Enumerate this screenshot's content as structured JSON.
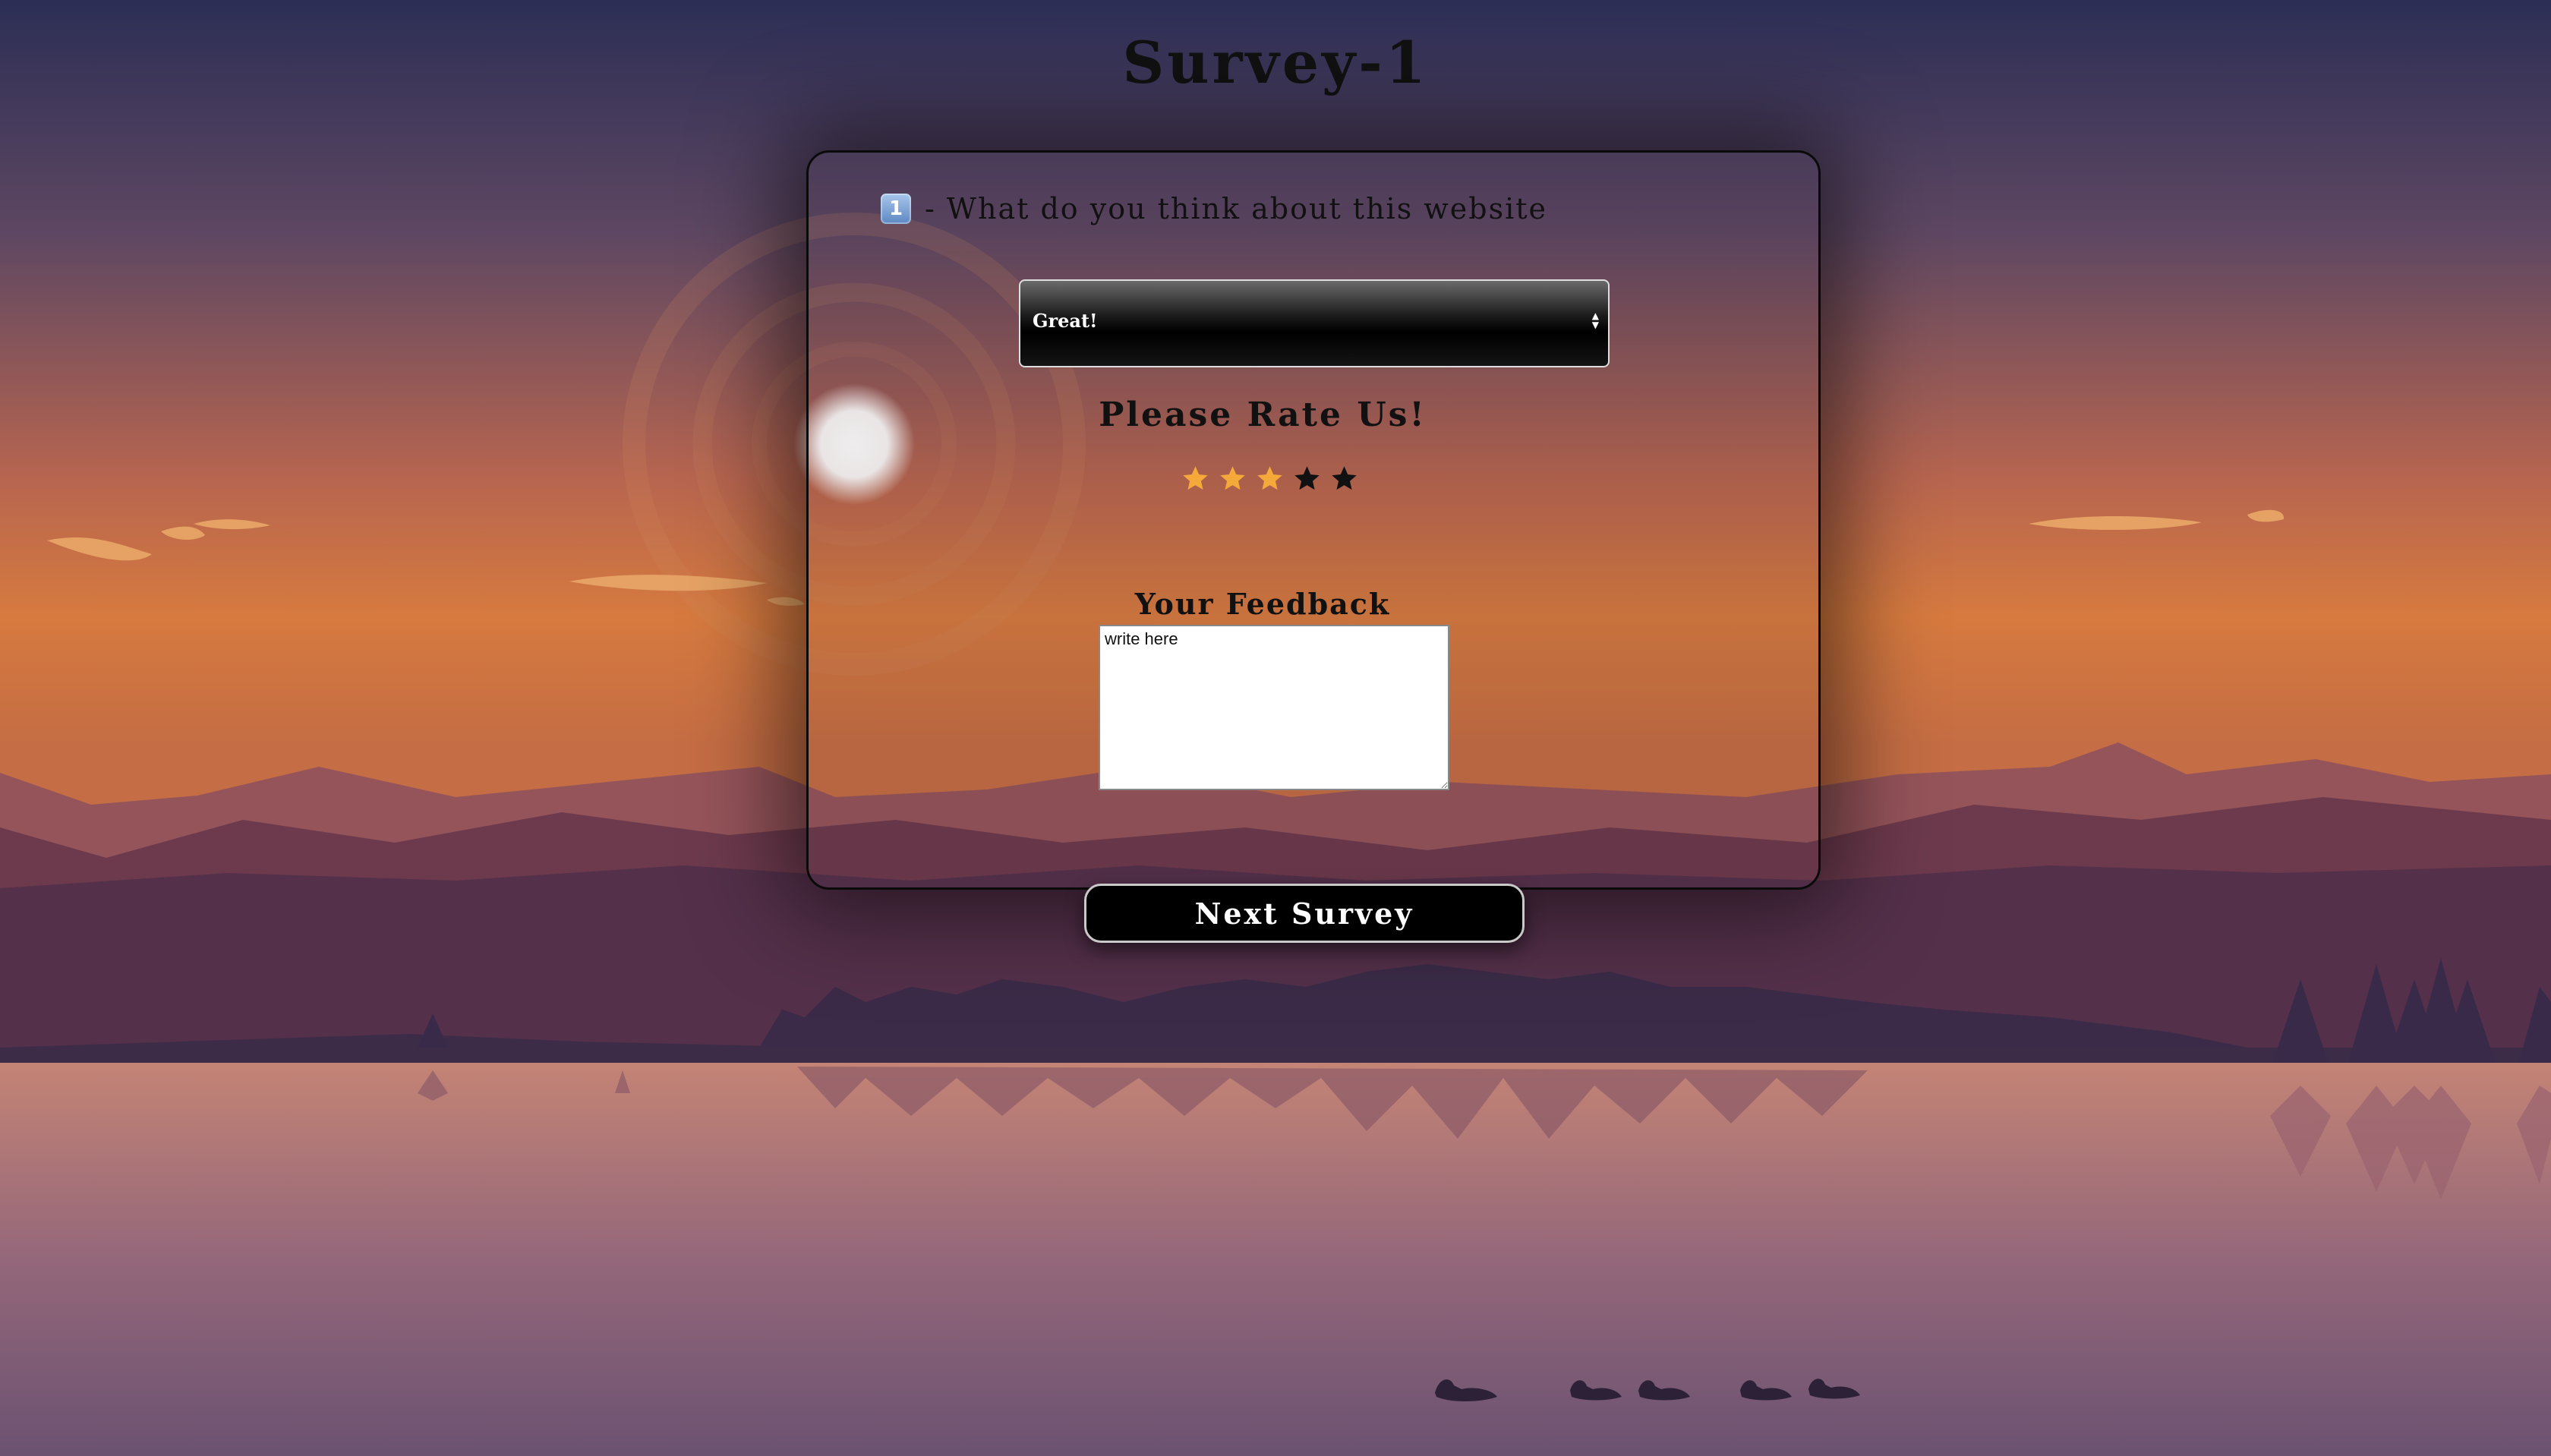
{
  "page": {
    "title": "Survey-1"
  },
  "survey": {
    "question_number": "1",
    "question_text": "- What do you think about this website",
    "select": {
      "selected": "Great!"
    },
    "rating": {
      "heading": "Please Rate Us!",
      "value": 3,
      "max": 5,
      "active_color": "#f5a93a",
      "inactive_color": "#111111"
    },
    "feedback": {
      "label": "Your Feedback",
      "value": "write here"
    },
    "next_button_label": "Next Survey"
  },
  "icons": {
    "question_badge": "keycap-1-icon",
    "select_arrows": "updown-arrows-icon",
    "rating": "star-icon"
  },
  "colors": {
    "card_border": "#0a0a0a",
    "button_bg": "#000000",
    "button_text": "#ffffff"
  }
}
